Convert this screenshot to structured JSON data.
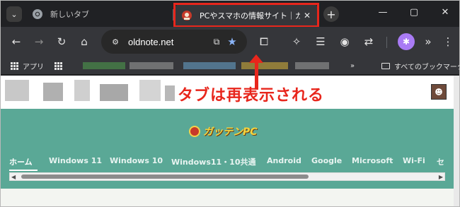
{
  "browser": {
    "tabs": [
      {
        "title": "新しいタブ",
        "active": false,
        "icon": "chrome-icon"
      },
      {
        "title": "PCやスマホの情報サイト｜ガッテンPC",
        "active": true,
        "icon": "gattenpc-favicon"
      }
    ],
    "omnibox": {
      "url": "oldnote.net"
    },
    "bookmarks": {
      "apps_label": "アプリ",
      "all_bookmarks_label": "すべてのブックマーク"
    }
  },
  "annotation": {
    "text": "タブは再表示される",
    "color": "#e8261c"
  },
  "site": {
    "logo_text": "ガッテンPC",
    "nav": [
      "ホーム",
      "Windows 11",
      "Windows 10",
      "Windows11・10共通",
      "Android",
      "Google",
      "Microsoft",
      "Wi-Fi",
      "セ"
    ],
    "header_color": "#5aa896",
    "logo_color": "#f6d33c"
  },
  "colors": {
    "highlight": "#e8261c",
    "tab_bg": "#35363a",
    "frame_bg": "#202124"
  }
}
